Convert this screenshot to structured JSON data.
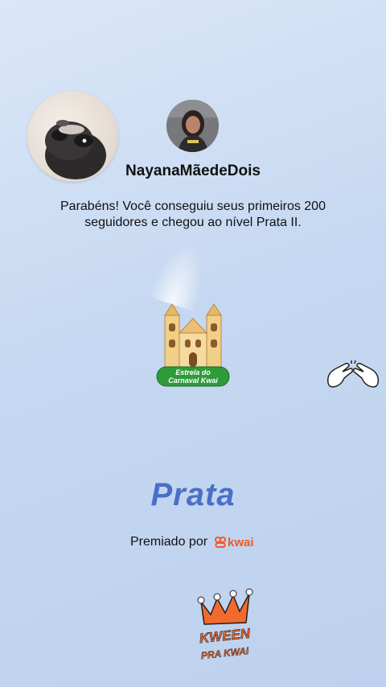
{
  "user": {
    "username": "NayanaMãedeDois"
  },
  "message": "Parabéns! Você conseguiu seus primeiros 200 seguidores e chegou ao nível Prata II.",
  "badge": {
    "label_line1": "Estrela do",
    "label_line2": "Carnaval Kwai"
  },
  "level": {
    "name": "Prata"
  },
  "award": {
    "prefix": "Premiado por",
    "brand": "kwai"
  },
  "footer_logo": {
    "line1": "KWEEN",
    "line2": "PRA KWAI"
  },
  "icons": [
    "church-icon",
    "clapping-hands-icon",
    "kwai-logo-icon",
    "crown-icon"
  ],
  "colors": {
    "level_blue": "#4a6fc7",
    "kwai_orange": "#f25a28",
    "badge_green": "#2e9b3a",
    "crown_orange": "#f26a2e"
  }
}
